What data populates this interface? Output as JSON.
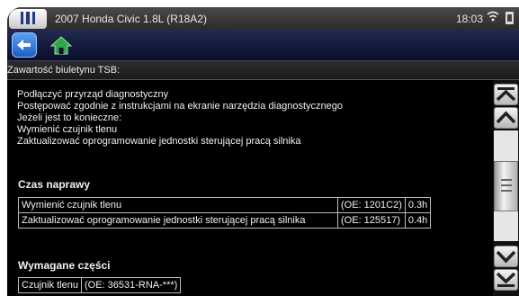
{
  "statusbar": {
    "vehicle": "2007 Honda Civic 1.8L (R18A2)",
    "time": "18:03"
  },
  "title": "Zawartość biuletynu TSB:",
  "instructions": [
    "Podłączyć przyrząd diagnostyczny",
    "Postępować zgodnie z instrukcjami na ekranie narzędzia diagnostycznego",
    "Jeżeli jest to konieczne:",
    "Wymienić czujnik tlenu",
    "Zaktualizować oprogramowanie jednostki sterującej pracą silnika"
  ],
  "repair_time": {
    "heading": "Czas naprawy",
    "rows": [
      {
        "task": "Wymienić czujnik tlenu",
        "oe": "(OE: 1201C2)",
        "hours": "0.3h"
      },
      {
        "task": "Zaktualizować oprogramowanie jednostki sterującej pracą silnika",
        "oe": "(OE: 125517)",
        "hours": "0.4h"
      }
    ]
  },
  "parts": {
    "heading": "Wymagane części",
    "rows": [
      {
        "part": "Czujnik tlenu",
        "oe": "(OE: 36531-RNA-***)"
      }
    ]
  },
  "colors": {
    "background": "#000000",
    "toolbar": "#0a0e2a",
    "accent": "#1d5fc4",
    "home_icon": "#2fa84a"
  },
  "icons": [
    "menu-icon",
    "wifi-icon",
    "battery-icon",
    "back-icon",
    "home-icon",
    "scroll-top-icon",
    "scroll-up-icon",
    "scroll-down-icon",
    "scroll-bottom-icon"
  ]
}
